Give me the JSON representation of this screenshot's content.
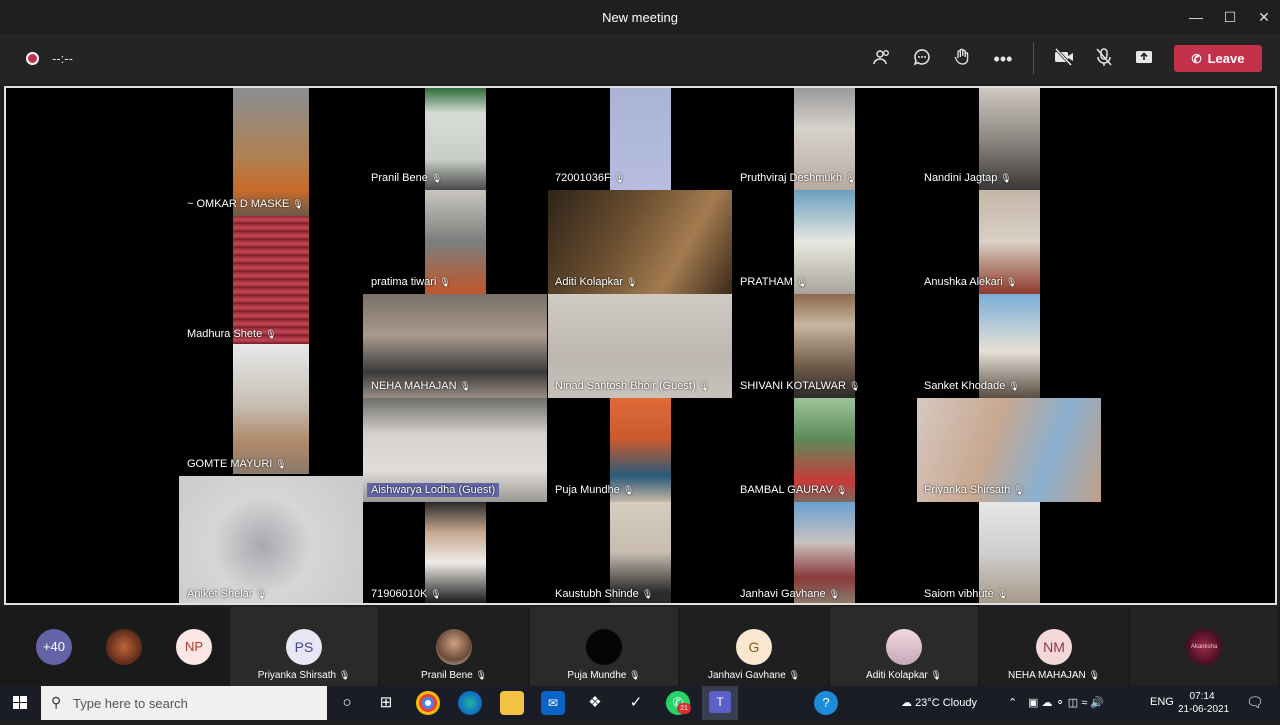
{
  "window": {
    "title": "New meeting"
  },
  "toolbar": {
    "timer": "--:--",
    "leave_label": "Leave"
  },
  "tiles": [
    {
      "name": "~ OMKAR D MASKE"
    },
    {
      "name": "Pranil Bene"
    },
    {
      "name": "72001036F"
    },
    {
      "name": "Pruthviraj Deshmukh"
    },
    {
      "name": "Nandini Jagtap"
    },
    {
      "name": "Madhura  Shete"
    },
    {
      "name": "pratima tiwari"
    },
    {
      "name": "Aditi Kolapkar"
    },
    {
      "name": "PRATHAM"
    },
    {
      "name": "Anushka Alekari"
    },
    {
      "name": "GOMTE MAYURI"
    },
    {
      "name": "NEHA MAHAJAN"
    },
    {
      "name": "Ninad Santosh Bhoir (Guest)"
    },
    {
      "name": "SHIVANI KOTALWAR"
    },
    {
      "name": "Sanket Khodade"
    },
    {
      "name": "Aniket Shelar"
    },
    {
      "name": "Aishwarya Lodha (Guest)"
    },
    {
      "name": "Puja Mundhe"
    },
    {
      "name": "BAMBAL GAURAV"
    },
    {
      "name": "Priyanka Shirsath"
    },
    {
      "name": "71906010K"
    },
    {
      "name": "Kaustubh Shinde"
    },
    {
      "name": "Janhavi Gavhane"
    },
    {
      "name": "Saiom vibhute"
    }
  ],
  "strip": {
    "more_count": "+40",
    "np_initials": "NP",
    "cards": [
      {
        "name": "Priyanka Shirsath",
        "initials": "PS"
      },
      {
        "name": "Pranil Bene",
        "initials": ""
      },
      {
        "name": "Puja Mundhe",
        "initials": ""
      },
      {
        "name": "Janhavi Gavhane",
        "initials": "G"
      },
      {
        "name": "Aditi Kolapkar",
        "initials": ""
      },
      {
        "name": "NEHA MAHAJAN",
        "initials": "NM"
      }
    ],
    "self_label": "Akanksha"
  },
  "taskbar": {
    "search_placeholder": "Type here to search",
    "weather": "23°C  Cloudy",
    "language": "ENG",
    "time": "07:14",
    "date": "21-06-2021",
    "whatsapp_badge": "21"
  }
}
